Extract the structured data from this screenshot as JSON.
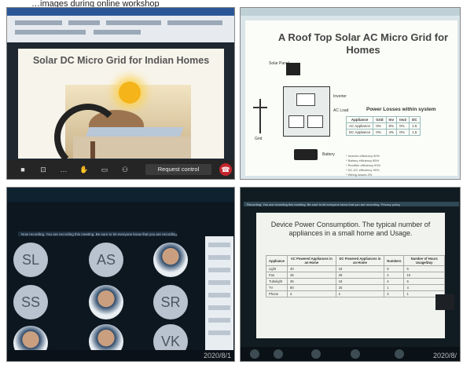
{
  "caption": "…images during online workshop",
  "panel1": {
    "title": "Solar DC Micro Grid for Indian Homes",
    "request_control": "Request control",
    "icons": [
      "camera-icon",
      "share-icon",
      "more-icon",
      "hand-icon",
      "chat-icon",
      "participants-icon"
    ]
  },
  "panel2": {
    "title": "A Roof Top Solar AC Micro Grid for Homes",
    "labels": {
      "solar_panel": "Solar Panel",
      "ac_load": "AC Load",
      "grid": "Grid",
      "battery": "Battery",
      "inverter": "Inverter"
    },
    "table_title": "Power Losses within system",
    "table_headers": [
      "Appliance",
      "Grid",
      "Inv",
      "Inv2",
      "DC"
    ],
    "table_rows": [
      [
        "AC Appliance",
        "0%",
        "8%",
        "0%",
        "1.5"
      ],
      [
        "DC Appliance",
        "0%",
        "4%",
        "0%",
        "1.5"
      ]
    ],
    "footnotes": [
      "* Inverter efficiency 90%",
      "* Battery efficiency 85%",
      "* Rectifier efficiency 90%",
      "* DC-DC efficiency 95%",
      "* Wiring losses 2%"
    ]
  },
  "panel3": {
    "recording_text": "Now recording. You are recording this meeting. Be sure to let everyone know that you are recording.",
    "participants": [
      "SL",
      "AS",
      "",
      "SS",
      "",
      "SR",
      "",
      "",
      "VK"
    ],
    "timestamp": "2020/8/1"
  },
  "panel4": {
    "recording_text": "Recording. You are recording this meeting. Be sure to let everyone know that you are recording. Privacy policy",
    "title": "Device Power Consumption. The typical number of appliances in a small home and Usage.",
    "table_headers": [
      "Appliance",
      "AC Powered Appliances in an Home",
      "DC Powered Appliances in an Home",
      "Numbers",
      "Number of Hours Usage/Day"
    ],
    "table_rows": [
      [
        "Light",
        "40",
        "18",
        "8",
        "6"
      ],
      [
        "Fan",
        "45",
        "28",
        "4",
        "10"
      ],
      [
        "Tubelight",
        "35",
        "18",
        "4",
        "6"
      ],
      [
        "TV",
        "80",
        "25",
        "1",
        "4"
      ],
      [
        "Phone",
        "3",
        "2",
        "3",
        "1"
      ]
    ],
    "timestamp": "2020/8/"
  }
}
